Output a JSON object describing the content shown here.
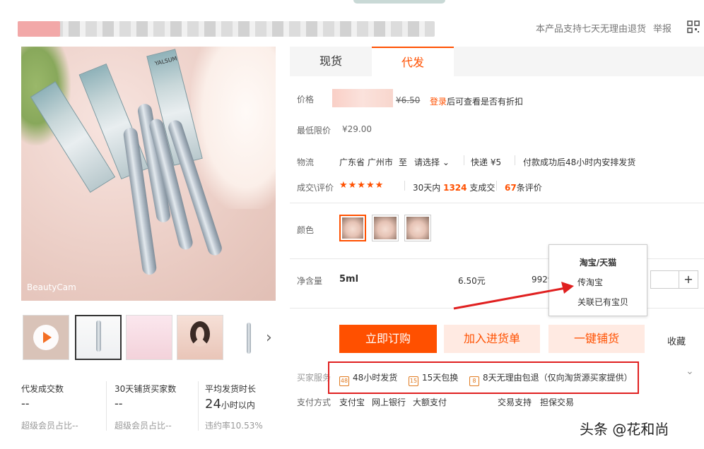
{
  "header": {
    "return_policy": "本产品支持七天无理由退货",
    "report": "举报",
    "qr_icon": "qr-code-icon"
  },
  "gallery": {
    "watermark": "BeautyCam",
    "box_brand": "YALSUM",
    "next_icon": "chevron-right-icon"
  },
  "stats": [
    {
      "label": "代发成交数",
      "value": "--",
      "sub": "超级会员占比--"
    },
    {
      "label": "30天铺货买家数",
      "value": "--",
      "sub": "超级会员占比--"
    },
    {
      "label": "平均发货时长",
      "value": "24",
      "unit": "小时以内",
      "sub": "违约率10.53%"
    }
  ],
  "tabs": [
    "现货",
    "代发"
  ],
  "price": {
    "label": "价格",
    "original": "¥6.50",
    "login": "登录",
    "login_suffix": "后可查看是否有折扣"
  },
  "min_price": {
    "label": "最低限价",
    "value": "¥29.00"
  },
  "logistics": {
    "label": "物流",
    "from": "广东省 广州市",
    "to": "至",
    "select": "请选择",
    "express": "快递 ¥5",
    "note": "付款成功后48小时内安排发货"
  },
  "deals": {
    "label": "成交\\评价",
    "stars": "★★★★★",
    "sold_prefix": "30天内",
    "sold_count": "1324",
    "sold_suffix": "支成交",
    "review_count": "67",
    "review_suffix": "条评价"
  },
  "color": {
    "label": "颜色"
  },
  "volume": {
    "label": "净含量",
    "spec": "5ml",
    "price": "6.50元",
    "stock": "9929",
    "plus": "+"
  },
  "popup": {
    "title": "淘宝/天猫",
    "items": [
      "传淘宝",
      "关联已有宝贝"
    ]
  },
  "buttons": {
    "buy": "立即订购",
    "add_list": "加入进货单",
    "distribute": "一键铺货",
    "favorite": "收藏"
  },
  "services": {
    "label": "买家服务",
    "items": [
      "48小时发货",
      "15天包换",
      "8天无理由包退（仅向淘货源买家提供）"
    ]
  },
  "payment": {
    "label": "支付方式",
    "methods": [
      "支付宝",
      "网上银行",
      "大额支付"
    ],
    "trade_label": "交易支持",
    "trade_value": "担保交易"
  },
  "footer_watermark": "头条 @花和尚",
  "colors": {
    "accent": "#ff5000",
    "highlight": "#e02020"
  }
}
